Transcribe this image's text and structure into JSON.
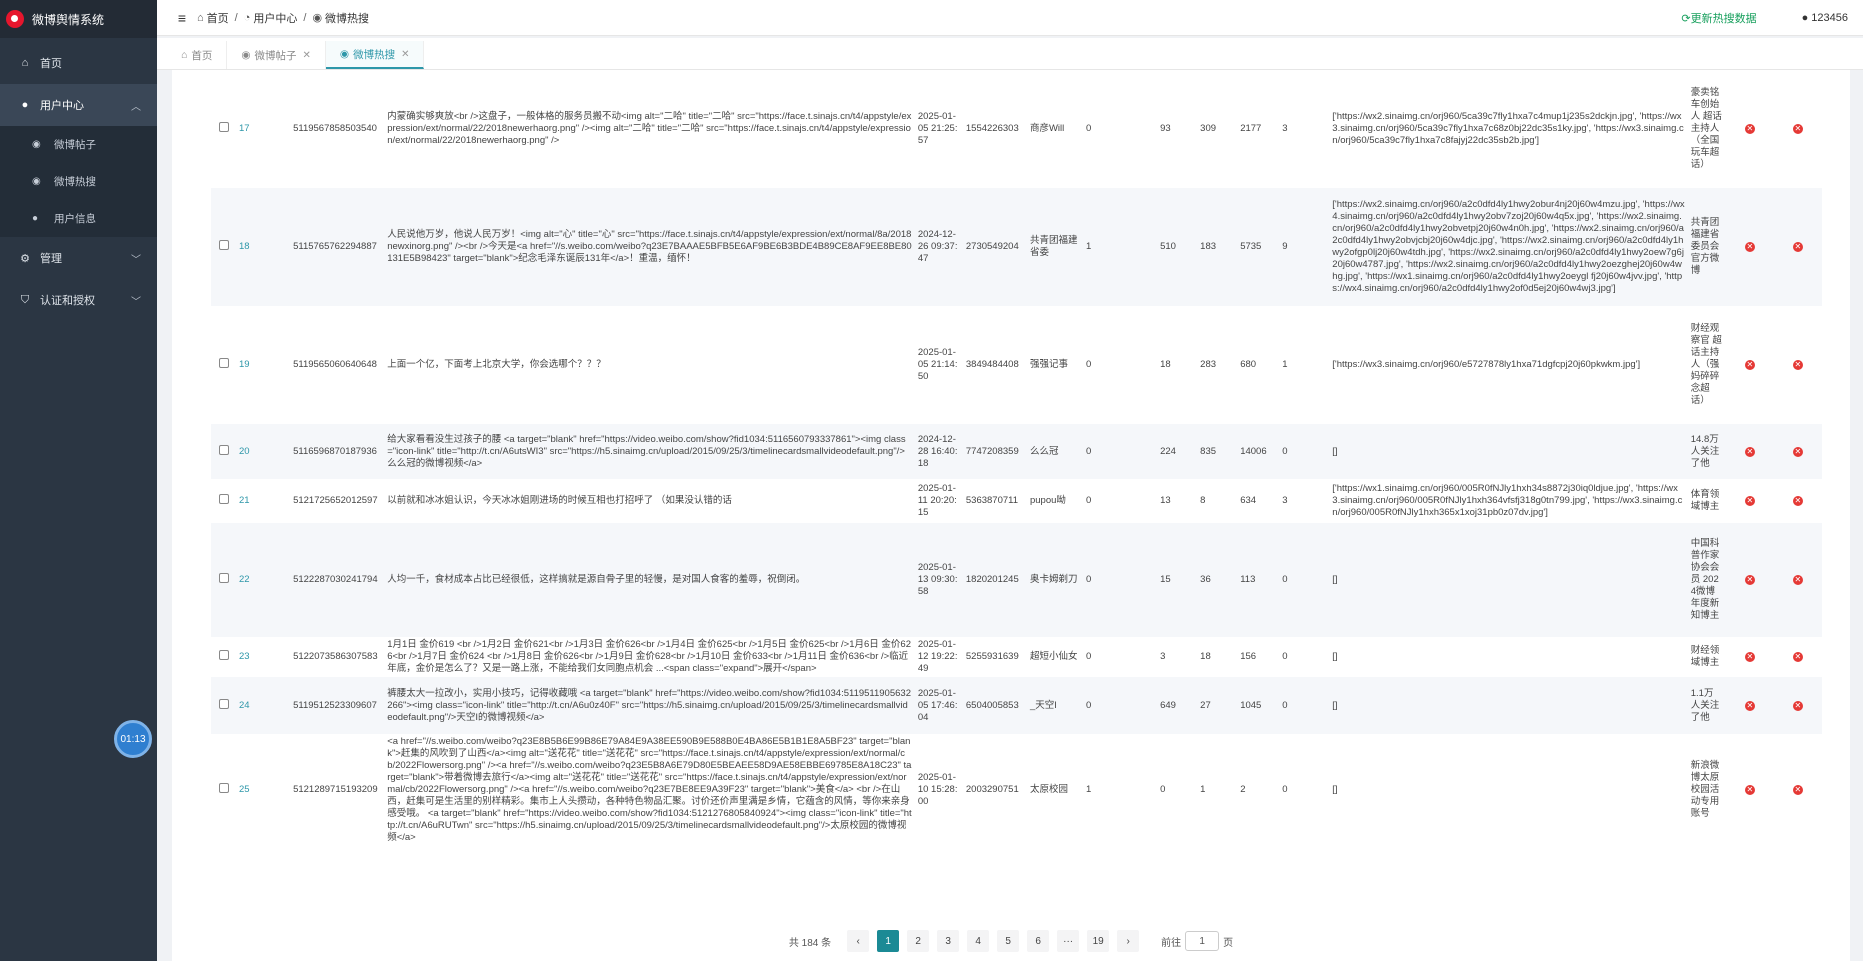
{
  "app": {
    "title": "微博舆情系统"
  },
  "sidebar": {
    "items": [
      {
        "label": "首页",
        "icon": "home-icon"
      },
      {
        "label": "用户中心",
        "icon": "user-icon"
      },
      {
        "label": "管理",
        "icon": "gear-icon"
      },
      {
        "label": "认证和授权",
        "icon": "shield-icon"
      }
    ],
    "sub": [
      {
        "label": "微博帖子",
        "icon": "weibo-icon"
      },
      {
        "label": "微博热搜",
        "icon": "weibo-icon"
      },
      {
        "label": "用户信息",
        "icon": "user-icon"
      }
    ]
  },
  "header": {
    "crumbs": [
      "首页",
      "用户中心",
      "微博热搜"
    ],
    "refresh": "更新热搜数据",
    "user": "123456"
  },
  "tabs": [
    {
      "label": "首页"
    },
    {
      "label": "微博帖子"
    },
    {
      "label": "微博热搜"
    }
  ],
  "rows": [
    {
      "idx": "17",
      "id": "5119567858503540",
      "text": "内蒙确实够爽放<br />这盘子，一般体格的服务员搬不动<img alt=\"二哈\" title=\"二哈\" src=\"https://face.t.sinajs.cn/t4/appstyle/expression/ext/normal/22/2018newerhaorg.png\" /><img alt=\"二哈\" title=\"二哈\" src=\"https://face.t.sinajs.cn/t4/appstyle/expression/ext/normal/22/2018newerhaorg.png\" />",
      "time": "2025-01-05 21:25:57",
      "uid": "1554226303",
      "name": "商彦Will",
      "n1": "0",
      "n2": "93",
      "n3": "309",
      "n4": "2177",
      "n5": "3",
      "imgs": "['https://wx2.sinaimg.cn/orj960/5ca39c7fly1hxa7c4mup1j235s2dckjn.jpg', 'https://wx3.sinaimg.cn/orj960/5ca39c7fly1hxa7c68z0bj22dc35s1ky.jpg', 'https://wx3.sinaimg.cn/orj960/5ca39c7fly1hxa7c8fajyj22dc35sb2b.jpg']",
      "desc": "豪卖铭车创始人 超话主持人（全国玩车超话）"
    },
    {
      "idx": "18",
      "id": "5115765762294887",
      "text": "人民说他万岁，他说人民万岁！<img alt=\"心\" title=\"心\" src=\"https://face.t.sinajs.cn/t4/appstyle/expression/ext/normal/8a/2018newxinorg.png\" /><br />今天是<a href=\"//s.weibo.com/weibo?q23E7BAAAE5BFB5E6AF9BE6B3BDE4B89CE8AF9EE8BE80131E5B98423\" target=\"blank\">纪念毛泽东诞辰131年</a>！重温，缅怀！",
      "time": "2024-12-26 09:37:47",
      "uid": "2730549204",
      "name": "共青团福建省委",
      "n1": "1",
      "n2": "510",
      "n3": "183",
      "n4": "5735",
      "n5": "9",
      "imgs": "['https://wx2.sinaimg.cn/orj960/a2c0dfd4ly1hwy2obur4nj20j60w4mzu.jpg', 'https://wx4.sinaimg.cn/orj960/a2c0dfd4ly1hwy2obv7zoj20j60w4q5x.jpg', 'https://wx2.sinaimg.cn/orj960/a2c0dfd4ly1hwy2obvetpj20j60w4n0h.jpg', 'https://wx2.sinaimg.cn/orj960/a2c0dfd4ly1hwy2obvjcbj20j60w4djc.jpg', 'https://wx2.sinaimg.cn/orj960/a2c0dfd4ly1hwy2ofgp0lj20j60w4tdh.jpg', 'https://wx2.sinaimg.cn/orj960/a2c0dfd4ly1hwy2oew7g6j20j60w4787.jpg', 'https://wx2.sinaimg.cn/orj960/a2c0dfd4ly1hwy2oezghej20j60w4whg.jpg', 'https://wx1.sinaimg.cn/orj960/a2c0dfd4ly1hwy2oeygl fj20j60w4jvv.jpg', 'https://wx4.sinaimg.cn/orj960/a2c0dfd4ly1hwy2of0d5ej20j60w4wj3.jpg']",
      "desc": "共青团福建省委员会官方微博"
    },
    {
      "idx": "19",
      "id": "5119565060640648",
      "text": "上面一个亿，下面考上北京大学，你会选哪个？？？",
      "time": "2025-01-05 21:14:50",
      "uid": "3849484408",
      "name": "强强记事",
      "n1": "0",
      "n2": "18",
      "n3": "283",
      "n4": "680",
      "n5": "1",
      "imgs": "['https://wx3.sinaimg.cn/orj960/e5727878ly1hxa71dgfcpj20j60pkwkm.jpg']",
      "desc": "财经观察官 超话主持人（强妈碎碎念超话）"
    },
    {
      "idx": "20",
      "id": "5116596870187936",
      "text": "给大家看看没生过孩子的腰 <a target=\"blank\" href=\"https://video.weibo.com/show?fid1034:5116560793337861\"><img class=\"icon-link\" title=\"http://t.cn/A6utsWI3\" src=\"https://h5.sinaimg.cn/upload/2015/09/25/3/timelinecardsmallvideodefault.png\"/>么么冠的微博视频</a>",
      "time": "2024-12-28 16:40:18",
      "uid": "7747208359",
      "name": "么么冠",
      "n1": "0",
      "n2": "224",
      "n3": "835",
      "n4": "14006",
      "n5": "0",
      "imgs": "[]",
      "desc": "14.8万人关注了他"
    },
    {
      "idx": "21",
      "id": "5121725652012597",
      "text": "以前就和冰冰姐认识，今天冰冰姐刚进场的时候互相也打招呼了 （如果没认错的话",
      "time": "2025-01-11 20:20:15",
      "uid": "5363870711",
      "name": "pupou呦",
      "n1": "0",
      "n2": "13",
      "n3": "8",
      "n4": "634",
      "n5": "3",
      "imgs": "['https://wx1.sinaimg.cn/orj960/005R0fNJly1hxh34s8872j30iq0ldjue.jpg', 'https://wx3.sinaimg.cn/orj960/005R0fNJly1hxh364vfsfj318g0tn799.jpg', 'https://wx3.sinaimg.cn/orj960/005R0fNJly1hxh365x1xoj31pb0z07dv.jpg']",
      "desc": "体育领域博主"
    },
    {
      "idx": "22",
      "id": "5122287030241794",
      "text": "人均一千，食材成本占比已经很低，这样搞就是源自骨子里的轻慢，是对国人食客的羞辱，祝倒闭。",
      "time": "2025-01-13 09:30:58",
      "uid": "1820201245",
      "name": "奥卡姆剃刀",
      "n1": "0",
      "n2": "15",
      "n3": "36",
      "n4": "113",
      "n5": "0",
      "imgs": "[]",
      "desc": "中国科普作家协会会员 2024微博年度新知博主"
    },
    {
      "idx": "23",
      "id": "5122073586307583",
      "text": "1月1日 金价619 <br />1月2日 金价621<br />1月3日 金价626<br />1月4日 金价625<br />1月5日 金价625<br />1月6日 金价626<br />1月7日 金价624 <br />1月8日 金价626<br />1月9日 金价628<br />1月10日 金价633<br />1月11日 金价636<br />临近年底，金价是怎么了？又是一路上涨，不能给我们女同胞点机会 ...<span class=\"expand\">展开</span>",
      "time": "2025-01-12 19:22:49",
      "uid": "5255931639",
      "name": "超短小仙女",
      "n1": "0",
      "n2": "3",
      "n3": "18",
      "n4": "156",
      "n5": "0",
      "imgs": "[]",
      "desc": "财经领域博主"
    },
    {
      "idx": "24",
      "id": "5119512523309607",
      "text": "裤腰太大一拉改小，实用小技巧，记得收藏哦 <a target=\"blank\" href=\"https://video.weibo.com/show?fid1034:5119511905632266\"><img class=\"icon-link\" title=\"http://t.cn/A6u0z40F\" src=\"https://h5.sinaimg.cn/upload/2015/09/25/3/timelinecardsmallvideodefault.png\"/>天空I的微博视频</a>",
      "time": "2025-01-05 17:46:04",
      "uid": "6504005853",
      "name": "_天空I",
      "n1": "0",
      "n2": "649",
      "n3": "27",
      "n4": "1045",
      "n5": "0",
      "imgs": "[]",
      "desc": "1.1万人关注了他"
    },
    {
      "idx": "25",
      "id": "5121289715193209",
      "text": "<a href=\"//s.weibo.com/weibo?q23E8B5B6E99B86E79A84E9A38EE590B9E588B0E4BA86E5B1B1E8A5BF23\" target=\"blank\">赶集的风吹到了山西</a><img alt=\"送花花\" title=\"送花花\" src=\"https://face.t.sinajs.cn/t4/appstyle/expression/ext/normal/cb/2022Flowersorg.png\" /><a href=\"//s.weibo.com/weibo?q23E5B8A6E79D80E5BEAEE58D9AE58EBBE69785E8A18C23\" target=\"blank\">带着微博去旅行</a><img alt=\"送花花\" title=\"送花花\" src=\"https://face.t.sinajs.cn/t4/appstyle/expression/ext/normal/cb/2022Flowersorg.png\" /><a href=\"//s.weibo.com/weibo?q23E7BE8EE9A39F23\" target=\"blank\">美食</a> <br />在山西，赶集可是生活里的别样精彩。集市上人头攒动，各种特色物品汇聚。讨价还价声里满是乡情，它蕴含的风情，等你来亲身感受哦。 <a target=\"blank\" href=\"https://video.weibo.com/show?fid1034:5121276805840924\"><img class=\"icon-link\" title=\"http://t.cn/A6uRUTwn\" src=\"https://h5.sinaimg.cn/upload/2015/09/25/3/timelinecardsmallvideodefault.png\"/>太原校园的微博视频</a>",
      "time": "2025-01-10 15:28:00",
      "uid": "2003290751",
      "name": "太原校园",
      "n1": "1",
      "n2": "0",
      "n3": "1",
      "n4": "2",
      "n5": "0",
      "imgs": "[]",
      "desc": "新浪微博太原校园活动专用账号"
    }
  ],
  "pager": {
    "total": "共 184 条",
    "pages": [
      "1",
      "2",
      "3",
      "4",
      "5",
      "6",
      "···",
      "19"
    ],
    "prev": "‹",
    "next": "›",
    "goto_prefix": "前往",
    "goto_value": "1",
    "goto_suffix": "页"
  },
  "timer": "01:13",
  "colors": {
    "accent": "#2e97a9",
    "sidebar": "#2b3643",
    "delete": "#e53935",
    "refresh": "#19a05e"
  }
}
